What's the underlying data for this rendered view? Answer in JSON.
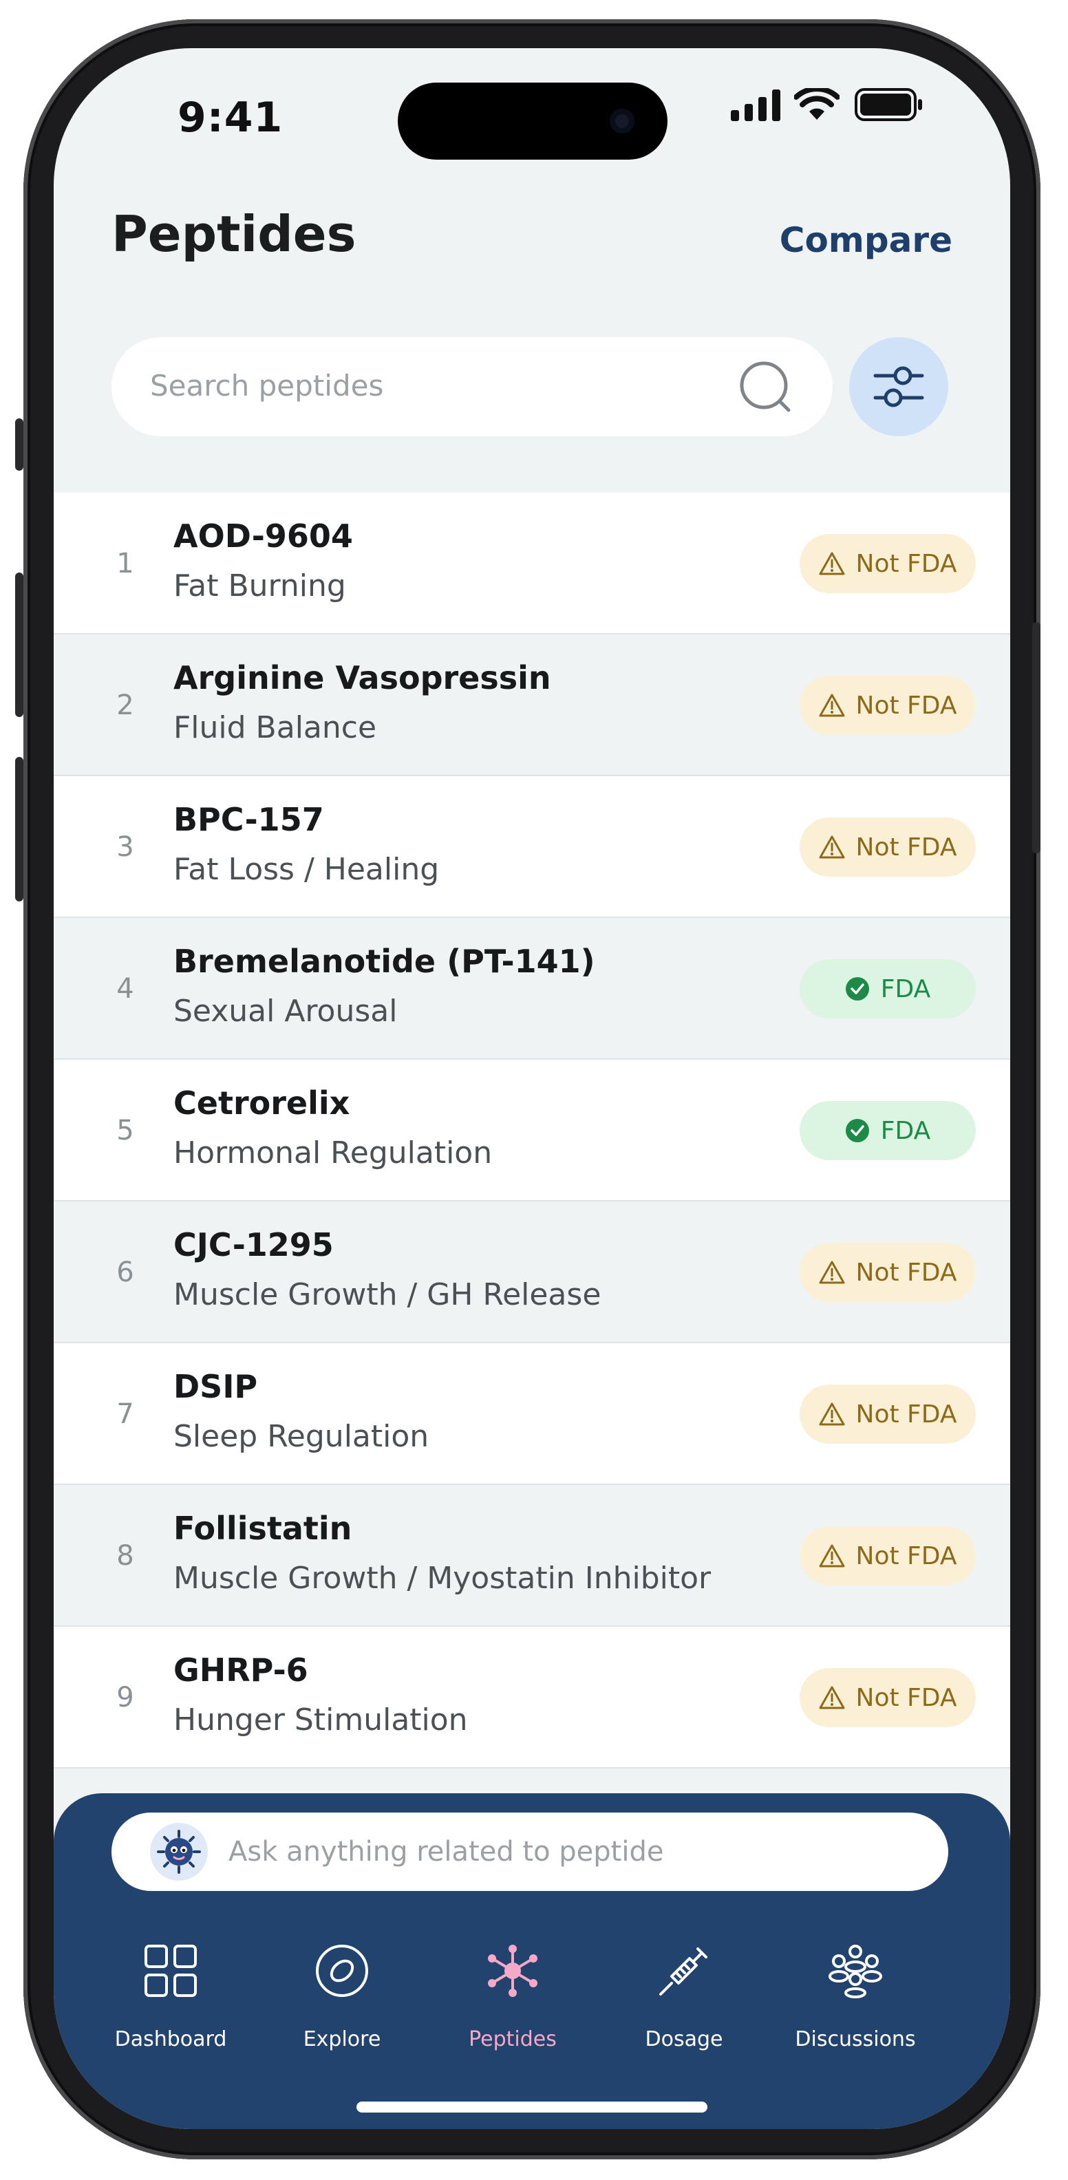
{
  "status_bar": {
    "time": "9:41"
  },
  "header": {
    "title": "Peptides",
    "compare_label": "Compare"
  },
  "search": {
    "placeholder": "Search peptides"
  },
  "peptides": [
    {
      "index": "1",
      "name": "AOD-9604",
      "category": "Fat Burning",
      "status": "Not FDA"
    },
    {
      "index": "2",
      "name": "Arginine Vasopressin",
      "category": "Fluid Balance",
      "status": "Not FDA"
    },
    {
      "index": "3",
      "name": "BPC-157",
      "category": "Fat Loss / Healing",
      "status": "Not FDA"
    },
    {
      "index": "4",
      "name": "Bremelanotide (PT-141)",
      "category": "Sexual Arousal",
      "status": "FDA"
    },
    {
      "index": "5",
      "name": "Cetrorelix",
      "category": "Hormonal Regulation",
      "status": "FDA"
    },
    {
      "index": "6",
      "name": "CJC-1295",
      "category": "Muscle Growth / GH Release",
      "status": "Not FDA"
    },
    {
      "index": "7",
      "name": "DSIP",
      "category": "Sleep Regulation",
      "status": "Not FDA"
    },
    {
      "index": "8",
      "name": "Follistatin",
      "category": "Muscle Growth / Myostatin Inhibitor",
      "status": "Not FDA"
    },
    {
      "index": "9",
      "name": "GHRP-6",
      "category": "Hunger Stimulation",
      "status": "Not FDA"
    }
  ],
  "assistant": {
    "placeholder": "Ask anything related to peptide"
  },
  "tab_bar": {
    "items": [
      {
        "label": "Dashboard",
        "icon": "dashboard-icon",
        "active": false
      },
      {
        "label": "Explore",
        "icon": "explore-icon",
        "active": false
      },
      {
        "label": "Peptides",
        "icon": "molecule-icon",
        "active": true
      },
      {
        "label": "Dosage",
        "icon": "syringe-icon",
        "active": false
      },
      {
        "label": "Discussions",
        "icon": "people-icon",
        "active": false
      }
    ]
  },
  "colors": {
    "brand_navy": "#21436e",
    "accent_pink": "#f4a9c9",
    "fda_green": "#1d8a48",
    "warning_amber": "#8d6a1a"
  }
}
